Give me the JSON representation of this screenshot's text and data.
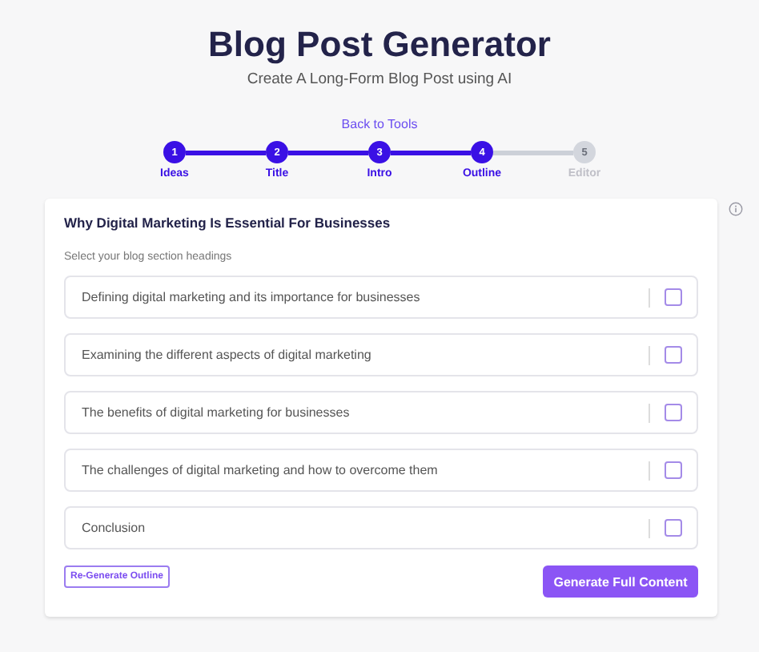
{
  "header": {
    "title": "Blog Post Generator",
    "subtitle": "Create A Long-Form Blog Post using AI",
    "back_link": "Back to Tools"
  },
  "steps": [
    {
      "number": "1",
      "label": "Ideas",
      "completed": true
    },
    {
      "number": "2",
      "label": "Title",
      "completed": true
    },
    {
      "number": "3",
      "label": "Intro",
      "completed": true
    },
    {
      "number": "4",
      "label": "Outline",
      "completed": true
    },
    {
      "number": "5",
      "label": "Editor",
      "completed": false
    }
  ],
  "card": {
    "title": "Why Digital Marketing Is Essential For Businesses",
    "instruction": "Select your blog section headings",
    "headings": [
      {
        "text": "Defining digital marketing and its importance for businesses",
        "checked": false
      },
      {
        "text": "Examining the different aspects of digital marketing",
        "checked": false
      },
      {
        "text": "The benefits of digital marketing for businesses",
        "checked": false
      },
      {
        "text": "The challenges of digital marketing and how to overcome them",
        "checked": false
      },
      {
        "text": "Conclusion",
        "checked": false
      }
    ],
    "regenerate_button": "Re-Generate Outline",
    "generate_button": "Generate Full Content"
  }
}
